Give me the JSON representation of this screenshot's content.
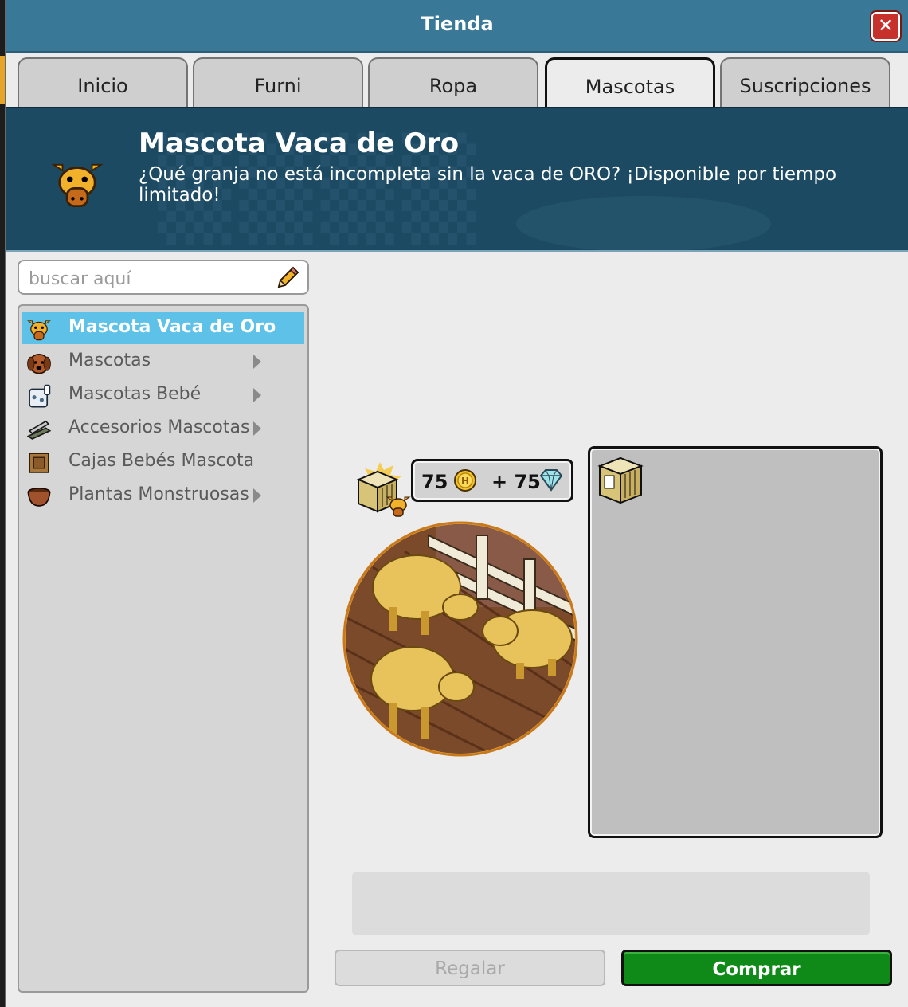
{
  "window": {
    "title": "Tienda"
  },
  "tabs": [
    {
      "label": "Inicio",
      "active": false
    },
    {
      "label": "Furni",
      "active": false
    },
    {
      "label": "Ropa",
      "active": false
    },
    {
      "label": "Mascotas",
      "active": true
    },
    {
      "label": "Suscripciones",
      "active": false
    }
  ],
  "banner": {
    "title": "Mascota Vaca de Oro",
    "description": "¿Qué granja no está incompleta sin la vaca de ORO? ¡Disponible por tiempo limitado!",
    "icon": "golden-cow-icon"
  },
  "search": {
    "placeholder": "buscar aquí",
    "value": ""
  },
  "nav": {
    "items": [
      {
        "label": "Mascota Vaca de Oro",
        "icon": "golden-cow-icon",
        "selected": true,
        "has_children": false
      },
      {
        "label": "Mascotas",
        "icon": "dog-icon",
        "selected": false,
        "has_children": true
      },
      {
        "label": "Mascotas Bebé",
        "icon": "baby-pet-icon",
        "selected": false,
        "has_children": true
      },
      {
        "label": "Accesorios Mascotas",
        "icon": "pet-accessories-icon",
        "selected": false,
        "has_children": true
      },
      {
        "label": "Cajas Bebés Mascota",
        "icon": "crate-icon",
        "selected": false,
        "has_children": false
      },
      {
        "label": "Plantas Monstruosas",
        "icon": "plant-pot-icon",
        "selected": false,
        "has_children": true
      }
    ]
  },
  "product": {
    "price": {
      "credits": "75",
      "plus": "+ 75",
      "credit_icon": "credit-coin-icon",
      "diamond_icon": "diamond-icon"
    }
  },
  "buttons": {
    "gift": "Regalar",
    "buy": "Comprar"
  },
  "colors": {
    "titlebar": "#3a7898",
    "banner": "#1d4a63",
    "selected_nav": "#5dc1e8",
    "buy_button": "#0f8a18"
  }
}
